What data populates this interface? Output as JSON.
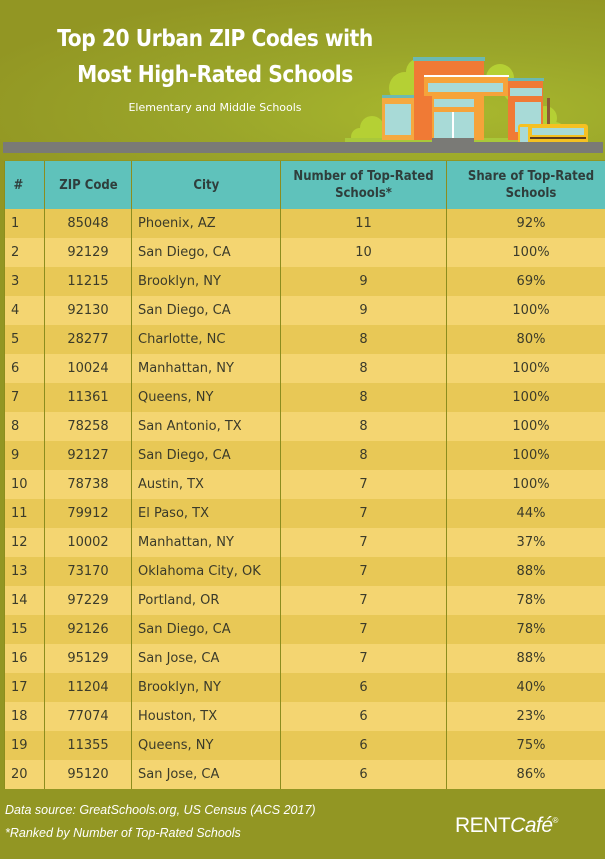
{
  "header": {
    "title_line1": "Top 20 Urban ZIP Codes with",
    "title_line2": "Most High-Rated Schools",
    "subtitle": "Elementary and Middle Schools",
    "illustration": "school-building-and-bus-illustration"
  },
  "colors": {
    "background": "#929623",
    "header_row": "#5fc2bb",
    "row_odd": "#e8c856",
    "row_even": "#f4d571",
    "building_orange": "#f07a35",
    "bus_yellow": "#f5c122"
  },
  "table": {
    "columns": [
      {
        "key": "rank",
        "label": "#"
      },
      {
        "key": "zip",
        "label": "ZIP Code"
      },
      {
        "key": "city",
        "label": "City"
      },
      {
        "key": "num",
        "label": "Number of Top-Rated Schools*"
      },
      {
        "key": "share",
        "label": "Share of Top-Rated Schools"
      }
    ],
    "rows": [
      {
        "rank": "1",
        "zip": "85048",
        "city": "Phoenix, AZ",
        "num": "11",
        "share": "92%"
      },
      {
        "rank": "2",
        "zip": "92129",
        "city": "San Diego, CA",
        "num": "10",
        "share": "100%"
      },
      {
        "rank": "3",
        "zip": "11215",
        "city": "Brooklyn, NY",
        "num": "9",
        "share": "69%"
      },
      {
        "rank": "4",
        "zip": "92130",
        "city": "San Diego, CA",
        "num": "9",
        "share": "100%"
      },
      {
        "rank": "5",
        "zip": "28277",
        "city": "Charlotte, NC",
        "num": "8",
        "share": "80%"
      },
      {
        "rank": "6",
        "zip": "10024",
        "city": "Manhattan, NY",
        "num": "8",
        "share": "100%"
      },
      {
        "rank": "7",
        "zip": "11361",
        "city": "Queens, NY",
        "num": "8",
        "share": "100%"
      },
      {
        "rank": "8",
        "zip": "78258",
        "city": "San Antonio, TX",
        "num": "8",
        "share": "100%"
      },
      {
        "rank": "9",
        "zip": "92127",
        "city": "San Diego, CA",
        "num": "8",
        "share": "100%"
      },
      {
        "rank": "10",
        "zip": "78738",
        "city": "Austin, TX",
        "num": "7",
        "share": "100%"
      },
      {
        "rank": "11",
        "zip": "79912",
        "city": "El Paso, TX",
        "num": "7",
        "share": "44%"
      },
      {
        "rank": "12",
        "zip": "10002",
        "city": "Manhattan, NY",
        "num": "7",
        "share": "37%"
      },
      {
        "rank": "13",
        "zip": "73170",
        "city": "Oklahoma City, OK",
        "num": "7",
        "share": "88%"
      },
      {
        "rank": "14",
        "zip": "97229",
        "city": "Portland, OR",
        "num": "7",
        "share": "78%"
      },
      {
        "rank": "15",
        "zip": "92126",
        "city": "San Diego, CA",
        "num": "7",
        "share": "78%"
      },
      {
        "rank": "16",
        "zip": "95129",
        "city": "San Jose, CA",
        "num": "7",
        "share": "88%"
      },
      {
        "rank": "17",
        "zip": "11204",
        "city": "Brooklyn, NY",
        "num": "6",
        "share": "40%"
      },
      {
        "rank": "18",
        "zip": "77074",
        "city": "Houston, TX",
        "num": "6",
        "share": "23%"
      },
      {
        "rank": "19",
        "zip": "11355",
        "city": "Queens, NY",
        "num": "6",
        "share": "75%"
      },
      {
        "rank": "20",
        "zip": "95120",
        "city": "San Jose, CA",
        "num": "6",
        "share": "86%"
      }
    ]
  },
  "footer": {
    "source": "Data source: GreatSchools.org, US Census (ACS 2017)",
    "note": "*Ranked by Number of Top-Rated Schools",
    "logo_rent": "RENT",
    "logo_cafe": "Café",
    "logo_reg": "®"
  }
}
